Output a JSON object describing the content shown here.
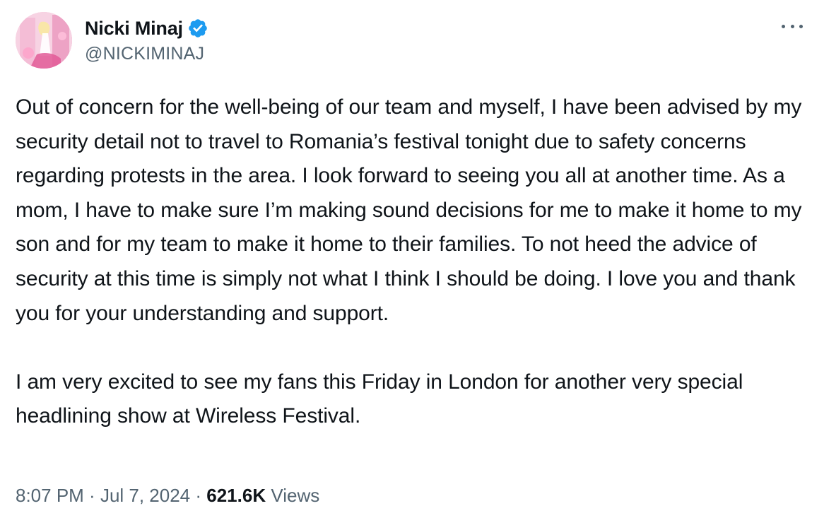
{
  "author": {
    "display_name": "Nicki Minaj",
    "handle": "@NICKIMINAJ",
    "verified_icon": "verified-badge-icon",
    "avatar": "profile-photo"
  },
  "menu": {
    "more_icon": "more-dots-icon"
  },
  "tweet": {
    "paragraphs": [
      "Out of concern for the well-being of our team and myself, I have been advised by my security detail not to travel to Romania’s festival tonight due to safety concerns regarding protests in the area. I look forward to seeing you all at another time. As a mom, I have to make sure I’m making sound decisions for me to make it home to my son and for my team to make it home to their families. To not heed the advice of security at this time is simply not what I think I should be doing. I love you and thank you for your understanding and support.",
      "I am very excited to see my fans this Friday in London for another very special headlining show at Wireless Festival."
    ]
  },
  "meta": {
    "time": "8:07 PM",
    "separator": " · ",
    "date": "Jul 7, 2024",
    "views_count": "621.6K",
    "views_label": " Views"
  },
  "colors": {
    "text": "#0f1419",
    "secondary": "#536471",
    "verified": "#1d9bf0"
  }
}
